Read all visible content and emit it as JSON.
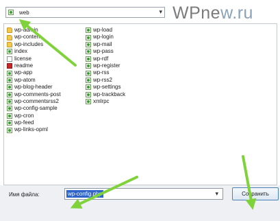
{
  "folder": {
    "current": "web"
  },
  "brand": {
    "text": "WPnew.ru",
    "part1": "WPne",
    "part2": "w.ru"
  },
  "files": {
    "column1": [
      {
        "name": "wp-admin",
        "type": "folder"
      },
      {
        "name": "wp-content",
        "type": "folder"
      },
      {
        "name": "wp-includes",
        "type": "folder"
      },
      {
        "name": "index",
        "type": "php"
      },
      {
        "name": "license",
        "type": "txt"
      },
      {
        "name": "readme",
        "type": "pdf"
      },
      {
        "name": "wp-app",
        "type": "php"
      },
      {
        "name": "wp-atom",
        "type": "php"
      },
      {
        "name": "wp-blog-header",
        "type": "php"
      },
      {
        "name": "wp-comments-post",
        "type": "php"
      },
      {
        "name": "wp-commentsrss2",
        "type": "php"
      },
      {
        "name": "wp-config-sample",
        "type": "php"
      },
      {
        "name": "wp-cron",
        "type": "php"
      },
      {
        "name": "wp-feed",
        "type": "php"
      },
      {
        "name": "wp-links-opml",
        "type": "php"
      }
    ],
    "column2": [
      {
        "name": "wp-load",
        "type": "php"
      },
      {
        "name": "wp-login",
        "type": "php"
      },
      {
        "name": "wp-mail",
        "type": "php"
      },
      {
        "name": "wp-pass",
        "type": "php"
      },
      {
        "name": "wp-rdf",
        "type": "php"
      },
      {
        "name": "wp-register",
        "type": "php"
      },
      {
        "name": "wp-rss",
        "type": "php"
      },
      {
        "name": "wp-rss2",
        "type": "php"
      },
      {
        "name": "wp-settings",
        "type": "php"
      },
      {
        "name": "wp-trackback",
        "type": "php"
      },
      {
        "name": "xmlrpc",
        "type": "php"
      }
    ]
  },
  "filename": {
    "label": "Имя файла:",
    "value": "wp-config.php"
  },
  "save_button": {
    "label": "Сохранить"
  },
  "colors": {
    "arrow": "#7fd23a",
    "selection": "#2f65c8"
  }
}
